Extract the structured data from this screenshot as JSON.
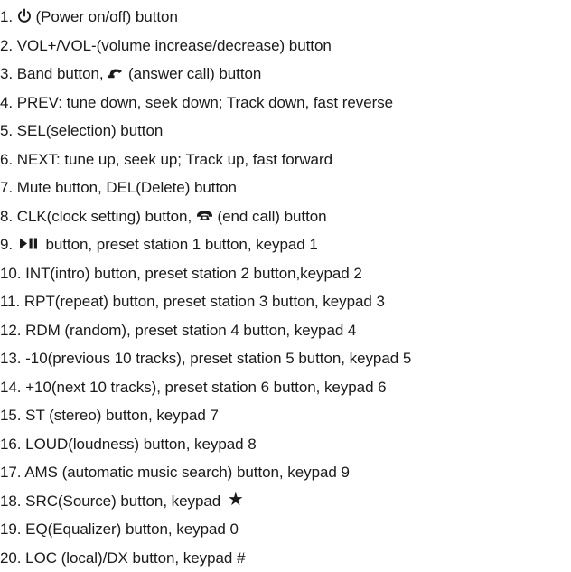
{
  "items": [
    {
      "num": "1.",
      "icon_before": "power-icon",
      "text": "(Power on/off) button"
    },
    {
      "num": "2.",
      "text": "VOL+/VOL-(volume increase/decrease) button"
    },
    {
      "num": "3.",
      "text_a": "Band button,",
      "icon": "answer-call-icon",
      "text_b": "(answer call) button"
    },
    {
      "num": "4.",
      "text": "PREV: tune down, seek down; Track down, fast reverse"
    },
    {
      "num": "5.",
      "text": "SEL(selection) button"
    },
    {
      "num": "6.",
      "text": "NEXT: tune up, seek up; Track up, fast forward"
    },
    {
      "num": "7.",
      "text": "Mute button, DEL(Delete) button"
    },
    {
      "num": "8.",
      "text_a": "CLK(clock setting) button,",
      "icon": "end-call-icon",
      "text_b": "(end call) button"
    },
    {
      "num": "9.",
      "icon_before": "play-pause-icon",
      "text": "button, preset station 1 button, keypad 1"
    },
    {
      "num": "10.",
      "text": "INT(intro) button, preset station 2 button,keypad 2"
    },
    {
      "num": "11.",
      "text": "RPT(repeat) button, preset station 3 button, keypad 3"
    },
    {
      "num": "12.",
      "text": "RDM (random), preset station 4 button, keypad 4"
    },
    {
      "num": "13.",
      "text": "-10(previous 10 tracks), preset station 5 button, keypad 5"
    },
    {
      "num": "14.",
      "text": "+10(next 10 tracks), preset station 6 button, keypad 6"
    },
    {
      "num": "15.",
      "text": "ST (stereo) button, keypad 7"
    },
    {
      "num": "16.",
      "text": "LOUD(loudness) button, keypad 8"
    },
    {
      "num": "17.",
      "text": "AMS (automatic music search) button, keypad 9"
    },
    {
      "num": "18.",
      "text_a": "SRC(Source) button, keypad",
      "icon": "star-icon"
    },
    {
      "num": "19.",
      "text": "EQ(Equalizer) button, keypad 0"
    },
    {
      "num": "20.",
      "text": "LOC (local)/DX button, keypad #"
    }
  ]
}
